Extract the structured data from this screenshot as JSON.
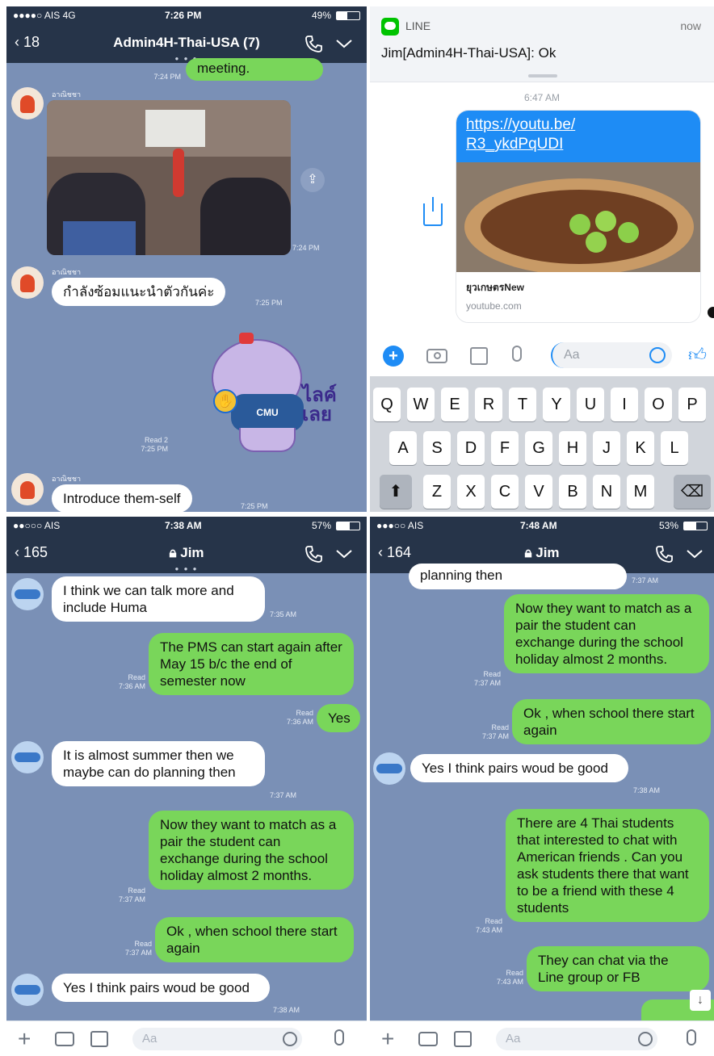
{
  "top_left": {
    "status": {
      "carrier": "●●●●○ AIS  4G",
      "time": "7:26 PM",
      "battery": "49%"
    },
    "nav": {
      "back": "18",
      "title": "Admin4H-Thai-USA (7)"
    },
    "prev_bubble": {
      "text": "meeting.",
      "time": "7:24 PM"
    },
    "messages": [
      {
        "sender": "อาณิชชา",
        "type": "photo",
        "time": "7:24 PM"
      },
      {
        "sender": "อาณิชชา",
        "text": "กำลังซ้อมแนะนำตัวกันค่ะ",
        "time": "7:25 PM"
      },
      {
        "type": "sticker",
        "sticker_text": "ไลค์\nเลย",
        "badge": "CMU",
        "read": "Read 2",
        "time": "7:25 PM"
      },
      {
        "sender": "อาณิชชา",
        "text": "Introduce them-self",
        "time": "7:25 PM"
      }
    ]
  },
  "top_right": {
    "notification": {
      "app": "LINE",
      "when": "now",
      "body": "Jim[Admin4H-Thai-USA]: Ok"
    },
    "timestamp": "6:47 AM",
    "link": {
      "url_line1": "https://youtu.be/",
      "url_line2": "R3_ykdPqUDI",
      "title": "ยุวเกษตรNew",
      "domain": "youtube.com"
    },
    "input_placeholder": "Aa",
    "keyboard": {
      "row1": [
        "Q",
        "W",
        "E",
        "R",
        "T",
        "Y",
        "U",
        "I",
        "O",
        "P"
      ],
      "row2": [
        "A",
        "S",
        "D",
        "F",
        "G",
        "H",
        "J",
        "K",
        "L"
      ],
      "row3": [
        "Z",
        "X",
        "C",
        "V",
        "B",
        "N",
        "M"
      ]
    }
  },
  "bottom_left": {
    "status": {
      "carrier": "●●○○○ AIS",
      "time": "7:38 AM",
      "battery": "57%"
    },
    "nav": {
      "back": "165",
      "title": "Jim"
    },
    "messages": [
      {
        "dir": "in",
        "text": "I think we can talk more and include Huma",
        "time": "7:35 AM"
      },
      {
        "dir": "out",
        "text": "The PMS can start again after May 15 b/c the end of semester now",
        "read": "Read",
        "time": "7:36 AM"
      },
      {
        "dir": "out",
        "text": "Yes",
        "read": "Read",
        "time": "7:36 AM"
      },
      {
        "dir": "in",
        "text": "It is almost summer then we maybe can do planning then",
        "time": "7:37 AM"
      },
      {
        "dir": "out",
        "text": "Now they want to match as a pair the student can exchange during the school holiday almost 2 months.",
        "read": "Read",
        "time": "7:37 AM"
      },
      {
        "dir": "out",
        "text": "Ok , when school there start again",
        "read": "Read",
        "time": "7:37 AM"
      },
      {
        "dir": "in",
        "text": "Yes I think pairs woud be good",
        "time": "7:38 AM"
      }
    ],
    "input_placeholder": "Aa"
  },
  "bottom_right": {
    "status": {
      "carrier": "●●●○○ AIS",
      "time": "7:48 AM",
      "battery": "53%"
    },
    "nav": {
      "back": "164",
      "title": "Jim"
    },
    "prev_bubble": {
      "text": "planning then",
      "time": "7:37 AM"
    },
    "messages": [
      {
        "dir": "out",
        "text": "Now they want to match as a pair the student can exchange during the school holiday almost 2 months.",
        "read": "Read",
        "time": "7:37 AM"
      },
      {
        "dir": "out",
        "text": "Ok , when school there start again",
        "read": "Read",
        "time": "7:37 AM"
      },
      {
        "dir": "in",
        "text": "Yes I think pairs woud be good",
        "time": "7:38 AM"
      },
      {
        "dir": "out",
        "text": "There are 4 Thai students that interested to chat with American friends . Can you ask students there that want to be a friend with these 4 students",
        "read": "Read",
        "time": "7:43 AM"
      },
      {
        "dir": "out",
        "text": "They can chat via the Line group or FB",
        "read": "Read",
        "time": "7:43 AM"
      }
    ],
    "input_placeholder": "Aa"
  },
  "colors": {
    "chat_bg": "#7a90b6",
    "nav_bg": "#263449",
    "out_bubble": "#79d65a",
    "in_bubble": "#ffffff",
    "link_bubble": "#1e8cf5"
  }
}
